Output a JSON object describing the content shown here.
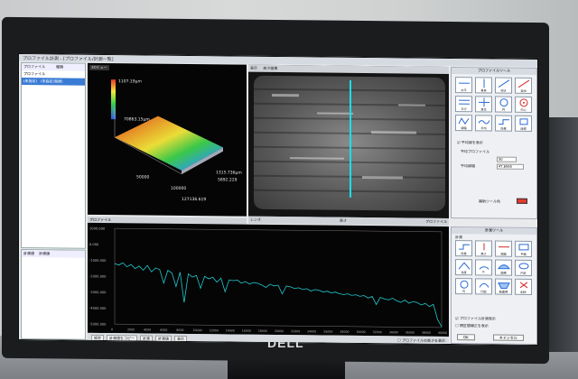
{
  "app": {
    "title": "プロファイル計測 - [プロファイル/計測一覧]",
    "brand_logo": "DELL"
  },
  "left_panel": {
    "headers": [
      "プロファイル",
      "種類"
    ],
    "rows": [
      {
        "name": "プロファイル",
        "type": "",
        "selected": false
      },
      {
        "name": "(未指定)",
        "type": "(未指定/直線)",
        "selected": true
      }
    ],
    "lower_header": [
      "計測値",
      "計測値"
    ]
  },
  "view3d": {
    "button": "3Dビュー",
    "label_x": "50000",
    "label_y": "100000",
    "label_z": "70863.15μm",
    "label_val1": "1315.736μm",
    "label_val2": "5892.229",
    "label_val3": "127136.619",
    "scale_top": "1107.19μm"
  },
  "image_view": {
    "toolbar_left": "表示",
    "toolbar_mid": "高さ画像",
    "footer_left": "レンズ",
    "footer_mid": "高さ",
    "footer_right": "プロファイル"
  },
  "chart_bar_label": "プロファイル",
  "chart_data": {
    "type": "line",
    "title": "",
    "xlabel": "",
    "ylabel": "",
    "y_ticks": [
      "1000.000",
      "0.000",
      "-1000.000",
      "-2000.000",
      "-3000.000",
      "-4000.000",
      "-5000.000"
    ],
    "x_ticks": [
      "0",
      "2000",
      "4000",
      "6000",
      "8000",
      "10000",
      "12000",
      "14000",
      "16000",
      "18000",
      "20000",
      "22000",
      "24000",
      "26000",
      "28000",
      "30000",
      "32000",
      "34000",
      "36000",
      "38000",
      "40000"
    ],
    "series": [
      {
        "color": "#1fc9cf",
        "x": [
          0,
          500,
          1000,
          1500,
          2000,
          2500,
          3000,
          3500,
          4000,
          4500,
          5000,
          5500,
          6000,
          6500,
          7000,
          7500,
          8000,
          8500,
          9000,
          9500,
          10000,
          10500,
          11000,
          11500,
          12000,
          12500,
          13000,
          13500,
          14000,
          14500,
          15000,
          15500,
          16000,
          16500,
          17000,
          17500,
          18000,
          18500,
          19000,
          19500,
          20000,
          20500,
          21000,
          21500,
          22000,
          22500,
          23000,
          23500,
          24000,
          24500,
          25000,
          25500,
          26000,
          26500,
          27000,
          27500,
          28000,
          28500,
          29000,
          29500,
          30000,
          30500,
          31000,
          31500,
          32000,
          32500,
          33000,
          33500,
          34000,
          34500,
          35000,
          35500,
          36000,
          36500,
          37000,
          37500,
          38000,
          38500,
          39000,
          39500,
          40000
        ],
        "y": [
          -1200,
          -1300,
          -1150,
          -1400,
          -1250,
          -1500,
          -1350,
          -1600,
          -1300,
          -1700,
          -1450,
          -1550,
          -2400,
          -1600,
          -1750,
          -2600,
          -1700,
          -3600,
          -1800,
          -2000,
          -1900,
          -2700,
          -1950,
          -2100,
          -2000,
          -2300,
          -2050,
          -2900,
          -2150,
          -2200,
          -2150,
          -2350,
          -2250,
          -2400,
          -2300,
          -2350,
          -2450,
          -2600,
          -2400,
          -2500,
          -2450,
          -3000,
          -2500,
          -2550,
          -2650,
          -2600,
          -2700,
          -2650,
          -2800,
          -2700,
          -2750,
          -2850,
          -2800,
          -2900,
          -2850,
          -2950,
          -3000,
          -2950,
          -3050,
          -3000,
          -3100,
          -3050,
          -3200,
          -3100,
          -3600,
          -3150,
          -3250,
          -3300,
          -3200,
          -3350,
          -3450,
          -3300,
          -3500,
          -3400,
          -3450,
          -3600,
          -3500,
          -3700,
          -3550,
          -4500,
          -4950
        ]
      }
    ],
    "ylim": [
      -5000,
      1000
    ],
    "xlim": [
      0,
      40000
    ],
    "grid": false
  },
  "bottom_toolbar": {
    "buttons": [
      "設定",
      "計測値をコピー",
      "計測",
      "計測値",
      "表示"
    ],
    "checkbox_label": "プロファイルの高さを表示"
  },
  "right_panel": {
    "header": "プロファイルツール",
    "icons": [
      "水平",
      "垂直",
      "傾き",
      "自由",
      "平行",
      "直交",
      "円",
      "中心",
      "線幅",
      "平均",
      "段差",
      "座標"
    ],
    "checkbox1": "平均線を表示",
    "field1_label": "平均プロファイル",
    "field1_value": "50",
    "field2_label": "平均線幅",
    "field2_value": "47.6595",
    "color_label": "補助ツール色",
    "color_value": "#e43a2f"
  },
  "measure_panel": {
    "header": "計測ツール",
    "tab": "計測",
    "icons": [
      "段差",
      "高さ",
      "距離",
      "平面",
      "角度",
      "R",
      "面積",
      "円柱",
      "円",
      "円弧",
      "断面積",
      "削除"
    ],
    "checkbox1": "プロファイル計測表示",
    "checkbox2": "閉区間補正を表示",
    "ok": "OK",
    "cancel": "キャンセル"
  }
}
